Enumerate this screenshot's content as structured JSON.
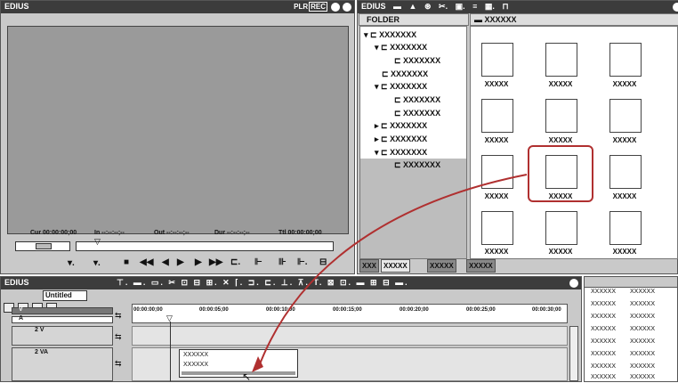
{
  "player": {
    "title": "EDIUS",
    "mode_label": "PLR",
    "rec_label": "REC",
    "timecodes": {
      "cur": "Cur 00:00:00;00",
      "in": "In --:--:--;--",
      "out": "Out --:--:--;--",
      "dur": "Dur --:--:--;--",
      "ttl": "Ttl 00:00:00;00"
    }
  },
  "bin": {
    "title": "EDIUS",
    "folder_header": "FOLDER",
    "path_label": "XXXXXX",
    "folders": [
      "XXXXXXX",
      "XXXXXXX",
      "XXXXXXX",
      "XXXXXXX",
      "XXXXXXX",
      "XXXXXXX",
      "XXXXXXX",
      "XXXXXXX",
      "XXXXXXX",
      "XXXXXXX",
      "XXXXXXX",
      "XXXXXXX"
    ],
    "clip_label": "XXXXX",
    "tabs": [
      "XXX",
      "XXXXX",
      "XXXXX",
      "XXXXX"
    ]
  },
  "timeline": {
    "title": "EDIUS",
    "sequence_name": "Untitled",
    "ruler": [
      "00:00:00;00",
      "00:00:05;00",
      "00:00:10;00",
      "00:00:15;00",
      "00:00:20;00",
      "00:00:25;00",
      "00:00:30;00"
    ],
    "tracks": {
      "v": "V",
      "a": "A",
      "t2v": "2 V",
      "t2va": "2 VA"
    },
    "clip": {
      "line1": "XXXXXX",
      "line2": "XXXXXX"
    }
  },
  "side_grid": {
    "rows": [
      [
        "XXXXXX",
        "XXXXXX"
      ],
      [
        "XXXXXX",
        "XXXXXX"
      ],
      [
        "XXXXXX",
        "XXXXXX"
      ],
      [
        "XXXXXX",
        "XXXXXX"
      ],
      [
        "XXXXXX",
        "XXXXXX"
      ],
      [
        "XXXXXX",
        "XXXXXX"
      ],
      [
        "XXXXXX",
        "XXXXXX"
      ],
      [
        "XXXXXX",
        "XXXXXX"
      ]
    ]
  },
  "colors": {
    "highlight": "#b03030",
    "titlebar": "#3c3c3c",
    "panel": "#c9c9c9"
  }
}
